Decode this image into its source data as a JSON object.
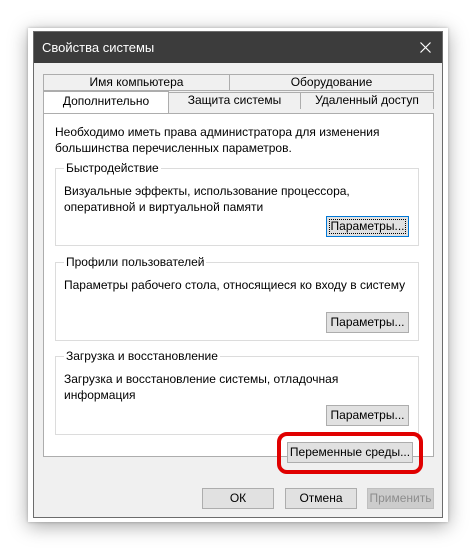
{
  "window": {
    "title": "Свойства системы",
    "close_icon": "close-icon"
  },
  "tabs": {
    "row1": [
      {
        "label": "Имя компьютера"
      },
      {
        "label": "Оборудование"
      }
    ],
    "row2": [
      {
        "label": "Дополнительно",
        "active": true
      },
      {
        "label": "Защита системы"
      },
      {
        "label": "Удаленный доступ"
      }
    ]
  },
  "panel": {
    "admin_notice": "Необходимо иметь права администратора для изменения большинства перечисленных параметров.",
    "performance": {
      "title": "Быстродействие",
      "description": "Визуальные эффекты, использование процессора, оперативной и виртуальной памяти",
      "button": "Параметры..."
    },
    "profiles": {
      "title": "Профили пользователей",
      "description": "Параметры рабочего стола, относящиеся ко входу в систему",
      "button": "Параметры..."
    },
    "startup": {
      "title": "Загрузка и восстановление",
      "description": "Загрузка и восстановление системы, отладочная информация",
      "button": "Параметры..."
    },
    "env_button": "Переменные среды..."
  },
  "footer": {
    "ok": "ОК",
    "cancel": "Отмена",
    "apply": "Применить"
  },
  "colors": {
    "titlebar": "#3c3c3c",
    "highlight": "#e00000",
    "focus": "#0078d7"
  }
}
